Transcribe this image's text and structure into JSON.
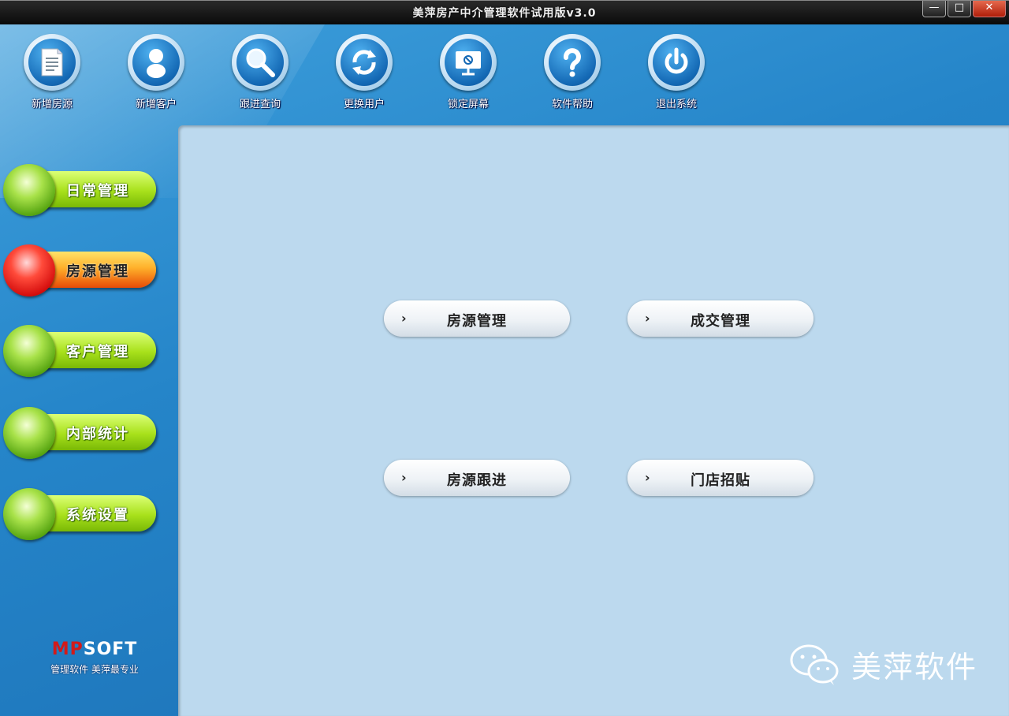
{
  "window": {
    "title": "美萍房产中介管理软件试用版v3.0",
    "minimize_glyph": "—",
    "maximize_glyph": "□",
    "close_glyph": "✕"
  },
  "toolbar": {
    "items": [
      {
        "label": "新增房源",
        "icon": "document-icon"
      },
      {
        "label": "新增客户",
        "icon": "user-icon"
      },
      {
        "label": "跟进查询",
        "icon": "magnifier-icon"
      },
      {
        "label": "更换用户",
        "icon": "refresh-icon"
      },
      {
        "label": "锁定屏幕",
        "icon": "monitor-lock-icon"
      },
      {
        "label": "软件帮助",
        "icon": "question-icon"
      },
      {
        "label": "退出系统",
        "icon": "power-icon"
      }
    ]
  },
  "sidebar": {
    "items": [
      {
        "label": "日常管理",
        "state": "normal"
      },
      {
        "label": "房源管理",
        "state": "active"
      },
      {
        "label": "客户管理",
        "state": "normal"
      },
      {
        "label": "内部统计",
        "state": "normal"
      },
      {
        "label": "系统设置",
        "state": "normal"
      }
    ],
    "brand": {
      "logo_mp": "MP",
      "logo_rest": "SOFT",
      "slogan": "管理软件 美萍最专业"
    }
  },
  "main": {
    "buttons": [
      {
        "label": "房源管理",
        "chevron": "›"
      },
      {
        "label": "成交管理",
        "chevron": "›"
      },
      {
        "label": "房源跟进",
        "chevron": "›"
      },
      {
        "label": "门店招贴",
        "chevron": "›"
      }
    ]
  },
  "watermark": {
    "text": "美萍软件",
    "icon": "wechat-icon"
  },
  "colors": {
    "title_bar": "#0a0a0a",
    "backdrop": "#2585c9",
    "panel": "#bcd9ee",
    "nav_green": "#a8e11b",
    "nav_active": "#e74b07"
  }
}
